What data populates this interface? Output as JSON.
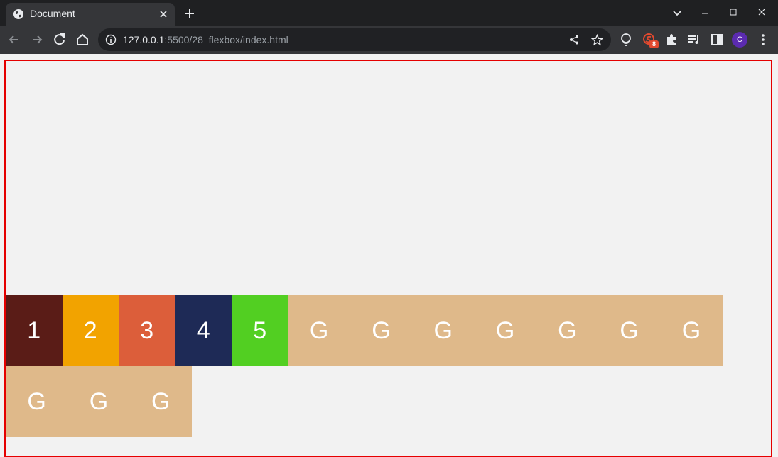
{
  "browser": {
    "tab_title": "Document",
    "url_host": "127.0.0.1",
    "url_path": ":5500/28_flexbox/index.html",
    "extension_badge": "8",
    "profile_initial": "C"
  },
  "page": {
    "numbered_items": [
      {
        "label": "1",
        "color": "#5a1c17"
      },
      {
        "label": "2",
        "color": "#f2a300"
      },
      {
        "label": "3",
        "color": "#dc5e3a"
      },
      {
        "label": "4",
        "color": "#1e2a56"
      },
      {
        "label": "5",
        "color": "#52cf22"
      }
    ],
    "g_items_row1": [
      "G",
      "G",
      "G",
      "G",
      "G",
      "G",
      "G"
    ],
    "g_items_row2": [
      "G",
      "G",
      "G"
    ],
    "g_color": "#dfb98a",
    "border_color": "#e50000"
  }
}
